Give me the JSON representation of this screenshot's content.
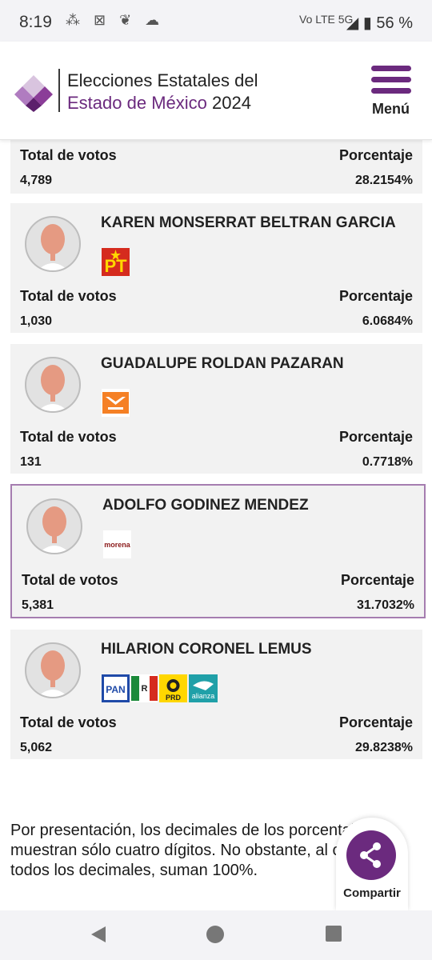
{
  "status_bar": {
    "time": "8:19",
    "network": "Vo LTE 5G",
    "battery": "56 %"
  },
  "header": {
    "title_line1": "Elecciones Estatales del",
    "title_line2_purple": "Estado de México",
    "title_line2_year": "2024",
    "menu_label": "Menú"
  },
  "partial_card": {
    "votes_label": "Total de votos",
    "votes": "4,789",
    "pct_label": "Porcentaje",
    "pct": "28.2154%"
  },
  "candidates": [
    {
      "name": "KAREN MONSERRAT BELTRAN GARCIA",
      "parties": [
        "PT"
      ],
      "votes_label": "Total de votos",
      "votes": "1,030",
      "pct_label": "Porcentaje",
      "pct": "6.0684%"
    },
    {
      "name": "GUADALUPE ROLDAN PAZARAN",
      "parties": [
        "Movimiento Ciudadano"
      ],
      "votes_label": "Total de votos",
      "votes": "131",
      "pct_label": "Porcentaje",
      "pct": "0.7718%"
    },
    {
      "name": "ADOLFO GODINEZ MENDEZ",
      "parties": [
        "morena"
      ],
      "party_logo_text": "morena",
      "votes_label": "Total de votos",
      "votes": "5,381",
      "pct_label": "Porcentaje",
      "pct": "31.7032%"
    },
    {
      "name": "HILARION CORONEL LEMUS",
      "parties": [
        "PAN",
        "PRI",
        "PRD",
        "alianza"
      ],
      "votes_label": "Total de votos",
      "votes": "5,062",
      "pct_label": "Porcentaje",
      "pct": "29.8238%"
    }
  ],
  "footnote": "Por presentación, los decimales de los porcentajes se muestran sólo cuatro dígitos. No obstante, al considerar todos los decimales, suman 100%.",
  "share": {
    "label": "Compartir"
  },
  "colors": {
    "brand_purple": "#6b2a7e",
    "selected_border": "#a57db0",
    "card_bg": "#f2f2f2"
  },
  "icons": [
    "bluetooth-icon",
    "signal-icon",
    "battery-icon",
    "menu-icon",
    "share-icon",
    "back-icon",
    "home-icon",
    "recents-icon"
  ]
}
